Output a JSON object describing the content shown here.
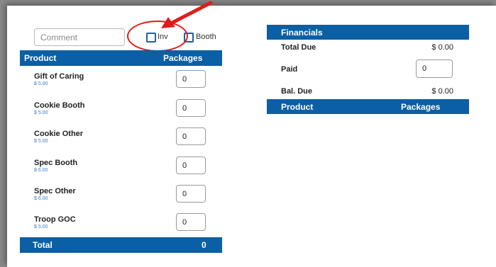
{
  "form": {
    "comment_placeholder": "Comment",
    "inv_label": "Inv",
    "booth_label": "Booth"
  },
  "products_table": {
    "header_product": "Product",
    "header_packages": "Packages",
    "rows": [
      {
        "name": "Gift of Caring",
        "price": "$ 5.00",
        "qty": "0"
      },
      {
        "name": "Cookie Booth",
        "price": "$ 5.00",
        "qty": "0"
      },
      {
        "name": "Cookie Other",
        "price": "$ 5.00",
        "qty": "0"
      },
      {
        "name": "Spec Booth",
        "price": "$ 6.00",
        "qty": "0"
      },
      {
        "name": "Spec Other",
        "price": "$ 6.00",
        "qty": "0"
      },
      {
        "name": "Troop GOC",
        "price": "$ 5.00",
        "qty": "0"
      }
    ],
    "total_label": "Total",
    "total_value": "0"
  },
  "financials": {
    "header": "Financials",
    "total_due_label": "Total Due",
    "total_due_value": "$ 0.00",
    "paid_label": "Paid",
    "paid_value": "0",
    "bal_due_label": "Bal. Due",
    "bal_due_value": "$ 0.00",
    "header_product": "Product",
    "header_packages": "Packages"
  },
  "colors": {
    "header_blue": "#0b5fa5",
    "checkbox_blue": "#1f5fa0",
    "annotation_red": "#e11b1b",
    "price_blue": "#3a7cc2"
  }
}
